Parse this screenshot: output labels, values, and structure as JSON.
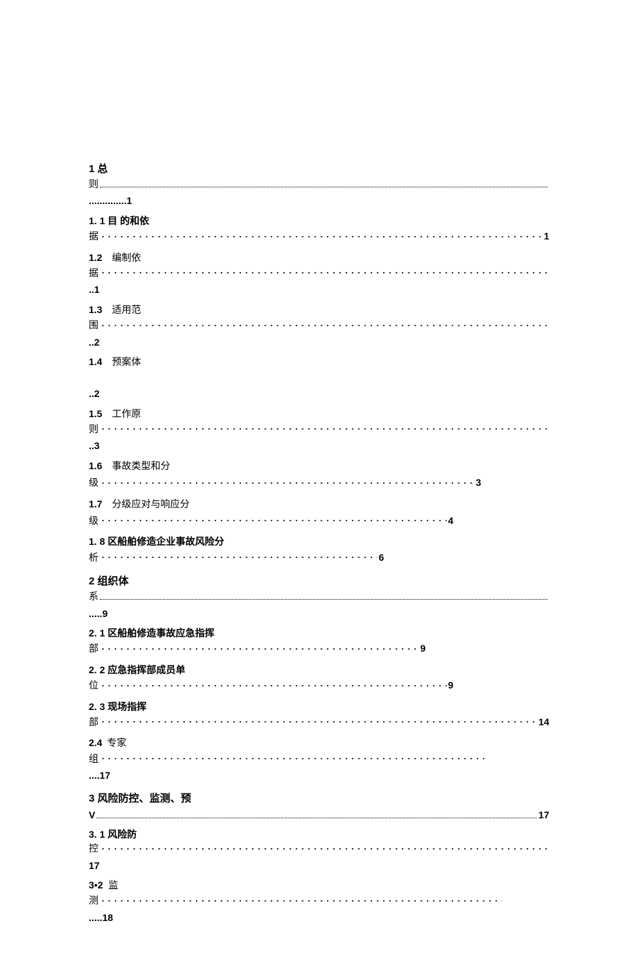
{
  "toc": {
    "s1": {
      "head_first": "1 总",
      "head_second": "则",
      "head_cont": " ..............1",
      "i1_num": "1.",
      "i1_label": "1 目 的和依",
      "i1_second": "据",
      "i1_page": " 1",
      "i2_num": "1.2",
      "i2_label": "编制依",
      "i2_second": "据",
      "i2_cont": "..1",
      "i3_num": "1.3",
      "i3_label": "适用范",
      "i3_second": "围",
      "i3_cont": "..2",
      "i4_num": "1.4",
      "i4_label": "预案体",
      "i4_cont": "..2",
      "i5_num": "1.5",
      "i5_label": "工作原",
      "i5_second": "则",
      "i5_cont": "..3",
      "i6_num": "1.6",
      "i6_label": "事故类型和分",
      "i6_second": "级",
      "i6_page": " 3",
      "i7_num": "1.7",
      "i7_label": "分级应对与响应分",
      "i7_second": "级",
      "i7_page": " 4",
      "i8_num": "1.",
      "i8_label": "8 区船舶修造企业事故风险分",
      "i8_second": "析",
      "i8_page": " 6"
    },
    "s2": {
      "head_first": "2 组织体",
      "head_second": "系",
      "head_cont": " .....9",
      "i1_num": "2.",
      "i1_label": "1 区船舶修造事故应急指挥",
      "i1_second": "部",
      "i1_page": " 9",
      "i2_num": "2.",
      "i2_label": "2 应急指挥部成员单",
      "i2_second": "位",
      "i2_page": " 9",
      "i3_num": "2.",
      "i3_label": "3 现场指挥",
      "i3_second": "部",
      "i3_page": " 14",
      "i4_num": "2.4",
      "i4_label": "专家",
      "i4_second": "组",
      "i4_cont": "....17"
    },
    "s3": {
      "head_first": "3 风险防控、监测、预",
      "head_second_prefix": "V",
      "head_second_page": "17",
      "i1_num": "3.",
      "i1_label": "1 风险防",
      "i1_second": "控",
      "i1_cont": "17",
      "i2_num": "3•2",
      "i2_label": "监",
      "i2_second": "测",
      "i2_cont": " .....18"
    }
  }
}
